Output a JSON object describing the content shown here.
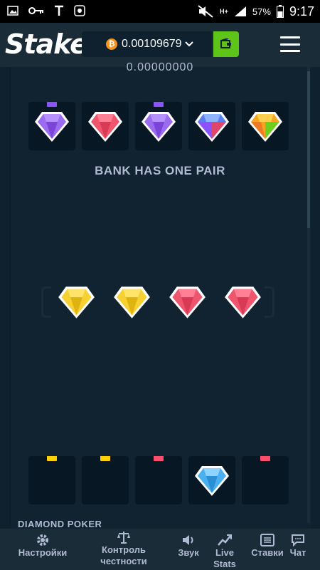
{
  "status_bar": {
    "network": "H+",
    "battery": "57%",
    "time": "9:17"
  },
  "header": {
    "logo": "Stake",
    "balance": "0.00109679",
    "currency_symbol": "₿",
    "caret": "⌄"
  },
  "game": {
    "payout_top": "0.00000000",
    "result_text": "BANK HAS ONE PAIR",
    "title_strip": "DIAMOND POKER",
    "dealer_gems": [
      {
        "color": "purple",
        "tag": "#8c52ff"
      },
      {
        "color": "red",
        "tag": ""
      },
      {
        "color": "purple",
        "tag": "#8c52ff"
      },
      {
        "color": "blue",
        "tag": ""
      },
      {
        "color": "orange",
        "tag": ""
      }
    ],
    "center_gems": [
      "yellow",
      "yellow",
      "red",
      "red"
    ],
    "player_slots": [
      {
        "gem": "",
        "tag": "#ffd000"
      },
      {
        "gem": "",
        "tag": "#ffd000"
      },
      {
        "gem": "",
        "tag": "#ff4d6d"
      },
      {
        "gem": "cyan",
        "tag": ""
      },
      {
        "gem": "",
        "tag": "#ff4d6d"
      }
    ]
  },
  "nav": {
    "settings": "Настройки",
    "fairness": "Контроль честности",
    "sound": "Звук",
    "live_stats": "Live Stats",
    "bets": "Ставки",
    "chat": "Чат"
  },
  "colors": {
    "bg": "#0f212e",
    "panel": "#1a2c38",
    "accent_green": "#5ec41a",
    "muted_text": "#b1bad3"
  }
}
